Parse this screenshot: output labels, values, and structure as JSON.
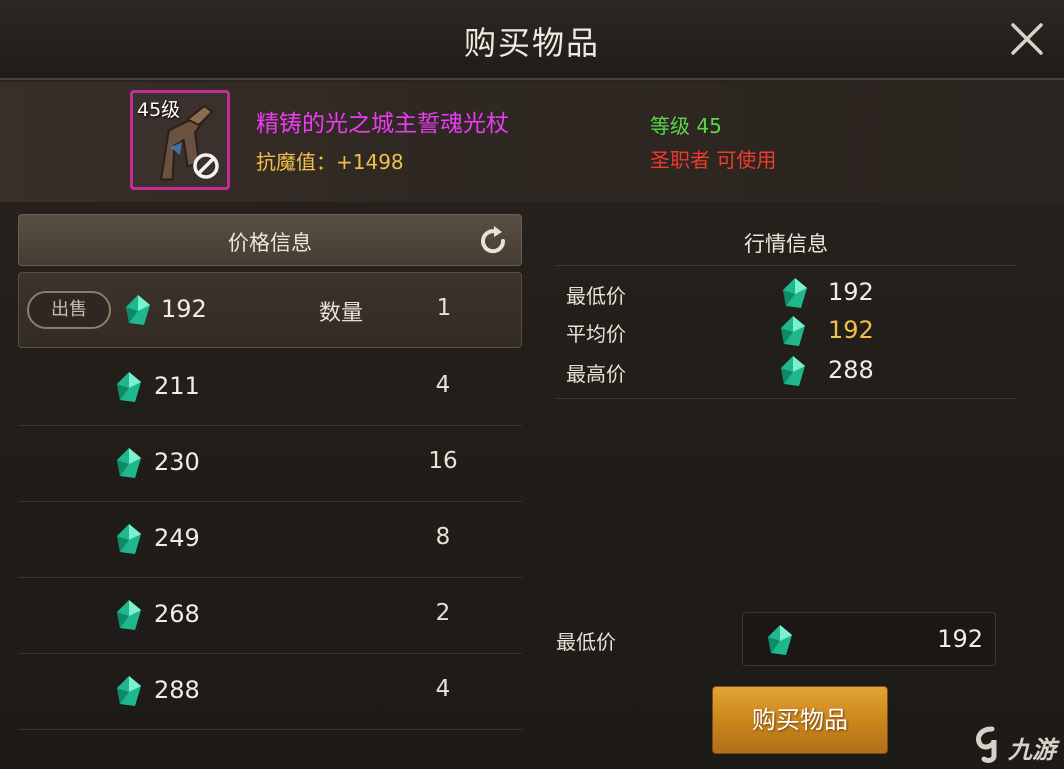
{
  "window": {
    "title": "购买物品"
  },
  "item": {
    "level_badge": "45级",
    "name": "精铸的光之城主誓魂光杖",
    "stat": "抗魔值：+1498",
    "level_requirement": "等级 45",
    "class_requirement": "圣职者 可使用",
    "border_color": "#c22d9a",
    "name_color": "#ea3cf0"
  },
  "price_panel": {
    "title": "价格信息",
    "refresh_icon": "refresh-icon",
    "sell_label": "出售",
    "quantity_label": "数量",
    "currency_icon": "gem-icon",
    "listings": [
      {
        "price": "192",
        "quantity": "1"
      },
      {
        "price": "211",
        "quantity": "4"
      },
      {
        "price": "230",
        "quantity": "16"
      },
      {
        "price": "249",
        "quantity": "8"
      },
      {
        "price": "268",
        "quantity": "2"
      },
      {
        "price": "288",
        "quantity": "4"
      }
    ]
  },
  "market_panel": {
    "title": "行情信息",
    "rows": [
      {
        "label": "最低价",
        "value": "192"
      },
      {
        "label": "平均价",
        "value": "192"
      },
      {
        "label": "最高价",
        "value": "288"
      }
    ]
  },
  "purchase": {
    "min_price_label": "最低价",
    "min_price_value": "192",
    "buy_button": "购买物品"
  },
  "watermark": {
    "text": "九游"
  },
  "colors": {
    "accent_gold": "#f0c04a",
    "level_green": "#58d84a",
    "class_red": "#ee3a2f",
    "gem": "#2fd6a8",
    "buy_button": "#d4921f"
  }
}
